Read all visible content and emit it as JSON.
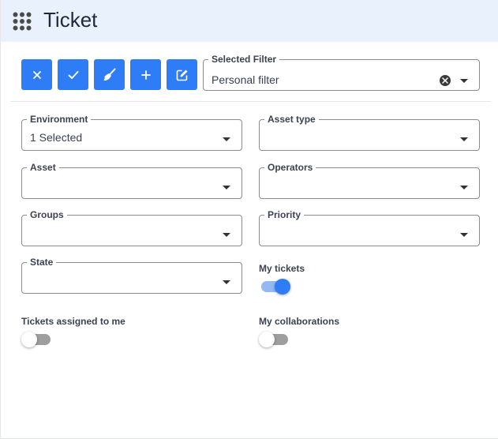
{
  "header": {
    "title": "Ticket",
    "icon": "apps-grid-icon"
  },
  "toolbar": {
    "buttons": [
      {
        "name": "close",
        "icon": "close-icon"
      },
      {
        "name": "confirm",
        "icon": "check-icon"
      },
      {
        "name": "clear",
        "icon": "broom-icon"
      },
      {
        "name": "add",
        "icon": "plus-icon"
      },
      {
        "name": "edit",
        "icon": "edit-icon"
      }
    ],
    "accent_color": "#2f7df6"
  },
  "selected_filter": {
    "label": "Selected Filter",
    "value": "Personal filter"
  },
  "filters": {
    "environment": {
      "label": "Environment",
      "value": "1 Selected"
    },
    "asset_type": {
      "label": "Asset type",
      "value": ""
    },
    "asset": {
      "label": "Asset",
      "value": ""
    },
    "operators": {
      "label": "Operators",
      "value": ""
    },
    "groups": {
      "label": "Groups",
      "value": ""
    },
    "priority": {
      "label": "Priority",
      "value": ""
    },
    "state": {
      "label": "State",
      "value": ""
    }
  },
  "toggles": {
    "my_tickets": {
      "label": "My tickets",
      "on": true
    },
    "assigned_to_me": {
      "label": "Tickets assigned to me",
      "on": false
    },
    "my_collaborations": {
      "label": "My collaborations",
      "on": false
    }
  }
}
